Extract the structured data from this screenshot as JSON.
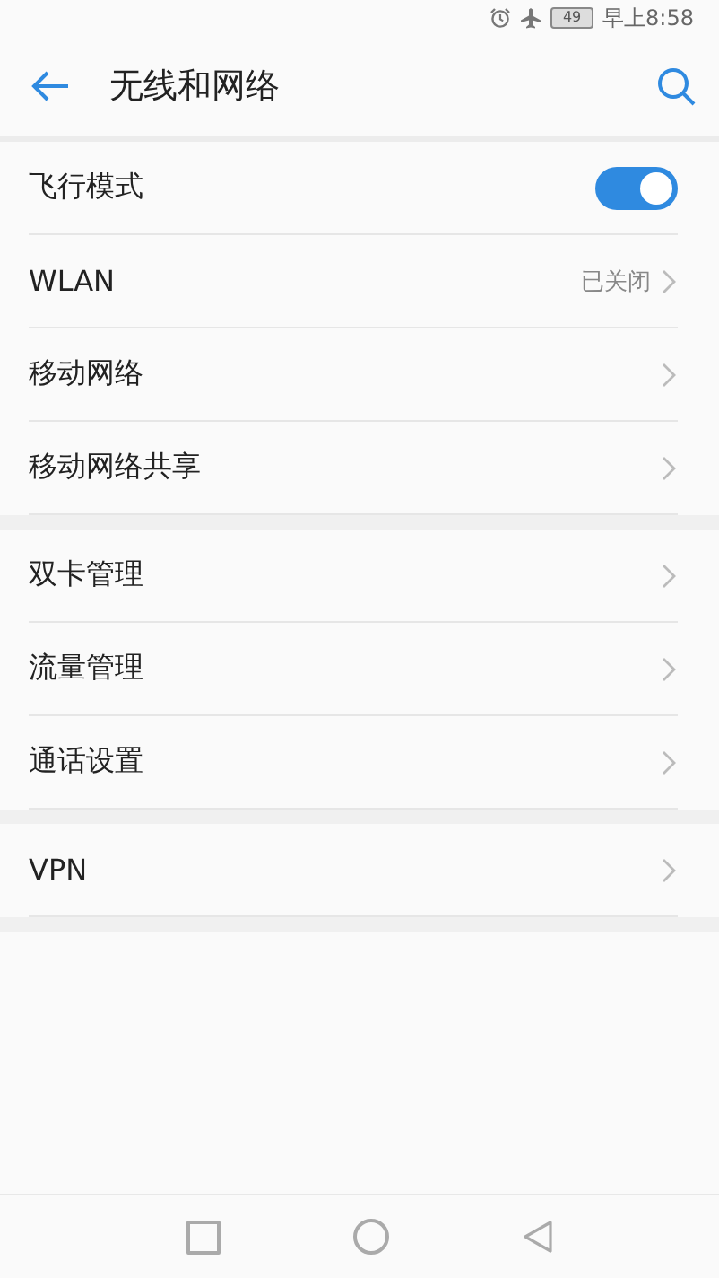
{
  "status_bar": {
    "battery": "49",
    "time": "早上8:58"
  },
  "header": {
    "title": "无线和网络"
  },
  "groups": [
    {
      "items": [
        {
          "kind": "toggle",
          "label": "飞行模式",
          "on": true
        },
        {
          "kind": "link",
          "label": "WLAN",
          "value": "已关闭"
        },
        {
          "kind": "link",
          "label": "移动网络"
        },
        {
          "kind": "link",
          "label": "移动网络共享"
        }
      ]
    },
    {
      "items": [
        {
          "kind": "link",
          "label": "双卡管理"
        },
        {
          "kind": "link",
          "label": "流量管理"
        },
        {
          "kind": "link",
          "label": "通话设置"
        }
      ]
    },
    {
      "items": [
        {
          "kind": "link",
          "label": "VPN"
        }
      ]
    }
  ]
}
